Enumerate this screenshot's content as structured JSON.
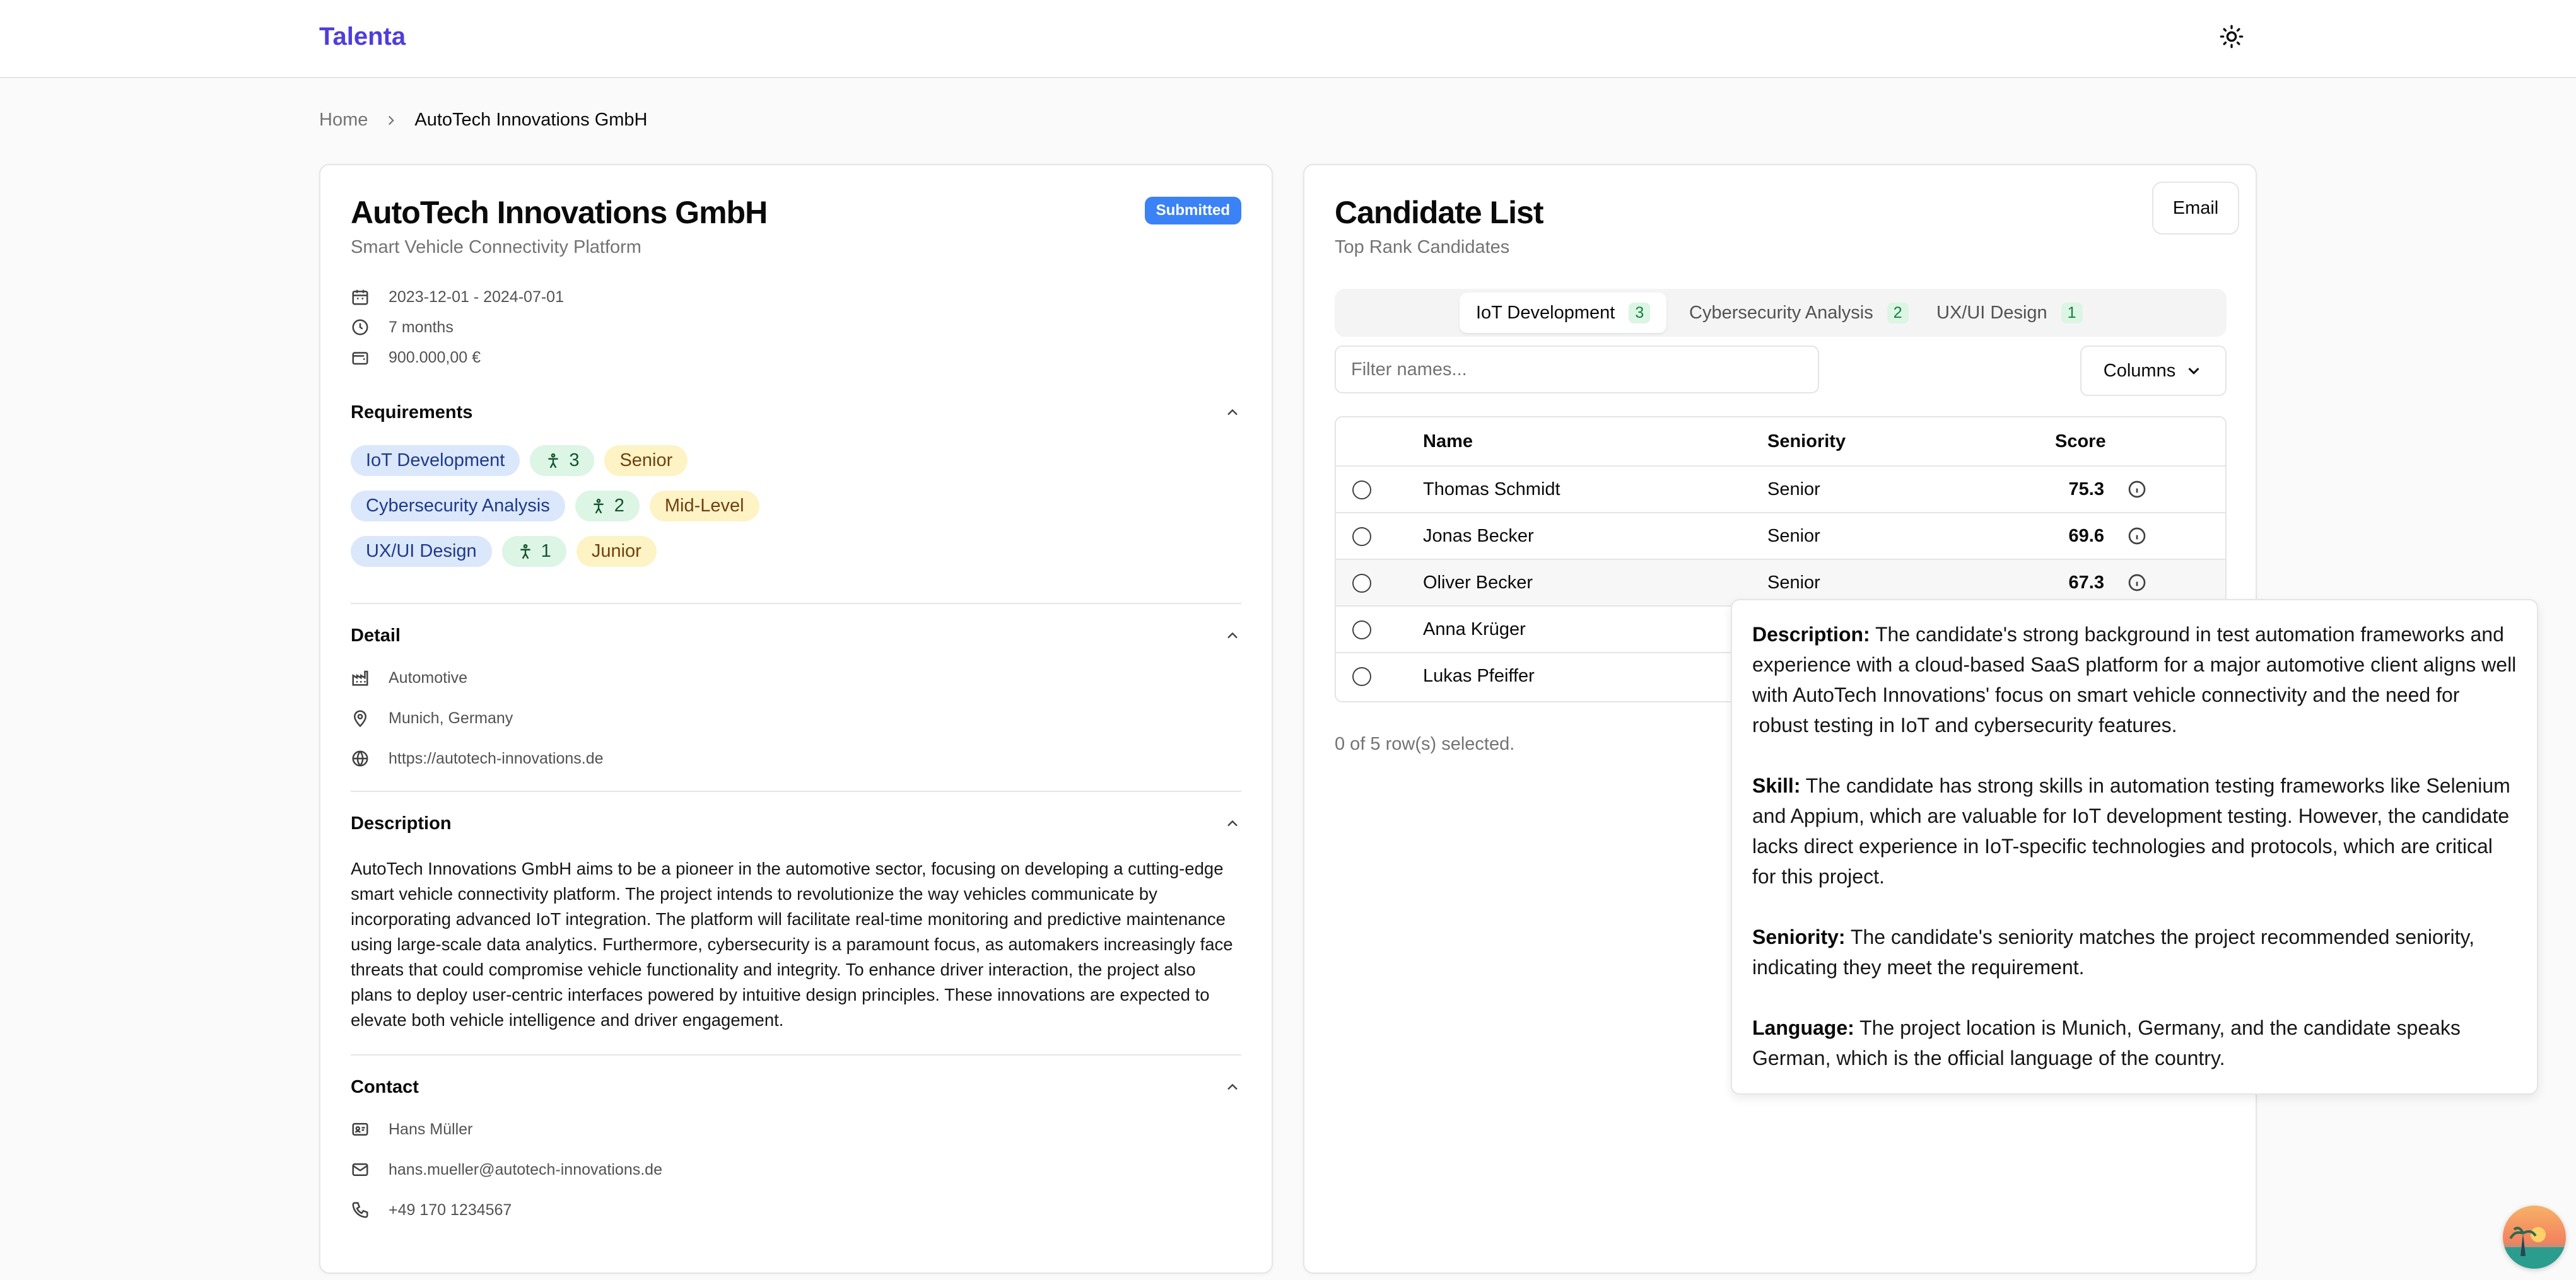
{
  "app": {
    "brand": "Talenta"
  },
  "breadcrumb": {
    "home": "Home",
    "current": "AutoTech Innovations GmbH"
  },
  "project": {
    "title": "AutoTech Innovations GmbH",
    "subtitle": "Smart Vehicle Connectivity Platform",
    "status": "Submitted",
    "dates": "2023-12-01 - 2024-07-01",
    "duration": "7 months",
    "budget": "900.000,00 €"
  },
  "requirements": {
    "title": "Requirements",
    "items": [
      {
        "skill": "IoT Development",
        "count": "3",
        "level": "Senior"
      },
      {
        "skill": "Cybersecurity Analysis",
        "count": "2",
        "level": "Mid-Level"
      },
      {
        "skill": "UX/UI Design",
        "count": "1",
        "level": "Junior"
      }
    ]
  },
  "detail": {
    "title": "Detail",
    "industry": "Automotive",
    "location": "Munich, Germany",
    "website": "https://autotech-innovations.de"
  },
  "description": {
    "title": "Description",
    "text": "AutoTech Innovations GmbH aims to be a pioneer in the automotive sector, focusing on developing a cutting-edge smart vehicle connectivity platform. The project intends to revolutionize the way vehicles communicate by incorporating advanced IoT integration. The platform will facilitate real-time monitoring and predictive maintenance using large-scale data analytics. Furthermore, cybersecurity is a paramount focus, as automakers increasingly face threats that could compromise vehicle functionality and integrity. To enhance driver interaction, the project also plans to deploy user-centric interfaces powered by intuitive design principles. These innovations are expected to elevate both vehicle intelligence and driver engagement."
  },
  "contact": {
    "title": "Contact",
    "name": "Hans Müller",
    "email": "hans.mueller@autotech-innovations.de",
    "phone": "+49 170 1234567"
  },
  "candidates": {
    "title": "Candidate List",
    "subtitle": "Top Rank Candidates",
    "email_label": "Email",
    "tabs": [
      {
        "label": "IoT Development",
        "count": "3"
      },
      {
        "label": "Cybersecurity Analysis",
        "count": "2"
      },
      {
        "label": "UX/UI Design",
        "count": "1"
      }
    ],
    "filter_placeholder": "Filter names...",
    "columns_label": "Columns",
    "headers": {
      "name": "Name",
      "seniority": "Seniority",
      "score": "Score"
    },
    "rows": [
      {
        "name": "Thomas Schmidt",
        "seniority": "Senior",
        "score": "75.3"
      },
      {
        "name": "Jonas Becker",
        "seniority": "Senior",
        "score": "69.6"
      },
      {
        "name": "Oliver Becker",
        "seniority": "Senior",
        "score": "67.3"
      },
      {
        "name": "Anna Krüger",
        "seniority": "",
        "score": ""
      },
      {
        "name": "Lukas Pfeiffer",
        "seniority": "",
        "score": ""
      }
    ],
    "selection": "0 of 5 row(s) selected."
  },
  "tooltip": {
    "description_label": "Description:",
    "description": " The candidate's strong background in test automation frameworks and experience with a cloud-based SaaS platform for a major automotive client aligns well with AutoTech Innovations' focus on smart vehicle connectivity and the need for robust testing in IoT and cybersecurity features.",
    "skill_label": "Skill:",
    "skill": " The candidate has strong skills in automation testing frameworks like Selenium and Appium, which are valuable for IoT development testing. However, the candidate lacks direct experience in IoT-specific technologies and protocols, which are critical for this project.",
    "seniority_label": "Seniority:",
    "seniority": " The candidate's seniority matches the project recommended seniority, indicating they meet the requirement.",
    "language_label": "Language:",
    "language": " The project location is Munich, Germany, and the candidate speaks German, which is the official language of the country."
  },
  "colors": {
    "brand": "#4f3ddc",
    "status_submitted": "#3b82f6",
    "skill_pill": "#dbe7fb",
    "count_pill": "#dcf5e5",
    "level_pill": "#fdf3c4"
  },
  "icons": [
    "sun-icon",
    "chevron-right-icon",
    "calendar-icon",
    "clock-icon",
    "wallet-icon",
    "chevron-up-icon",
    "person-icon",
    "factory-icon",
    "map-pin-icon",
    "globe-icon",
    "contact-card-icon",
    "mail-icon",
    "phone-icon",
    "chevron-down-icon",
    "info-icon"
  ]
}
